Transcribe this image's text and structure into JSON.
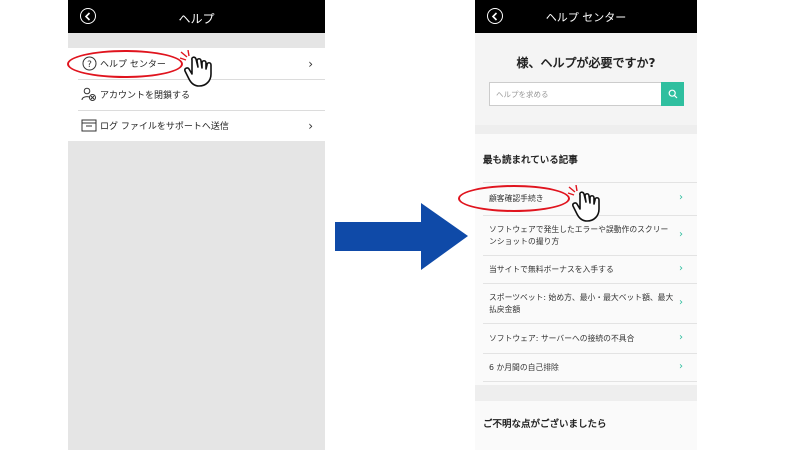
{
  "left": {
    "header_title": "ヘルプ",
    "items": [
      {
        "label": "ヘルプ センター",
        "icon": "question-circle-icon",
        "has_chevron": true
      },
      {
        "label": "アカウントを閉鎖する",
        "icon": "close-account-icon",
        "has_chevron": false
      },
      {
        "label": "ログ ファイルをサポートへ送信",
        "icon": "log-file-icon",
        "has_chevron": true
      }
    ]
  },
  "right": {
    "header_title": "ヘルプ センター",
    "heading": "様、ヘルプが必要ですか?",
    "search_placeholder": "ヘルプを求める",
    "section_title": "最も読まれている記事",
    "articles": [
      "顧客確認手続き",
      "ソフトウェアで発生したエラーや誤動作のスクリーンショットの撮り方",
      "当サイトで無料ボーナスを入手する",
      "スポーツベット: 始め方、最小・最大ベット額、最大払戻金額",
      "ソフトウェア: サーバーへの接続の不具合",
      "6 か月間の自己排除"
    ],
    "footer_title": "ご不明な点がございましたら"
  },
  "colors": {
    "highlight_ring": "#e0141e",
    "arrow": "#0f4aa8",
    "accent": "#2fbf9f",
    "nav_bg": "#000000"
  }
}
